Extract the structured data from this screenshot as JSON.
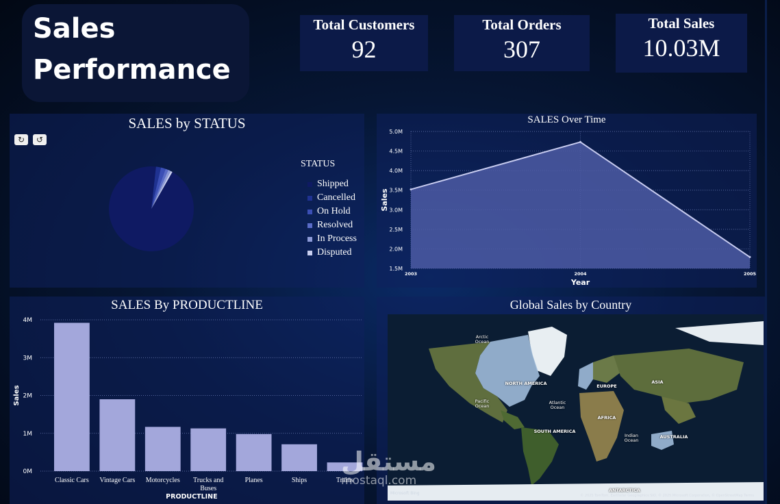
{
  "header": {
    "title_line1": "Sales",
    "title_line2": "Performance"
  },
  "kpis": [
    {
      "label": "Total Customers",
      "value": "92"
    },
    {
      "label": "Total Orders",
      "value": "307"
    },
    {
      "label": "Total Sales",
      "value": "10.03M"
    }
  ],
  "status_panel": {
    "title": "SALES by STATUS",
    "legend_title": "STATUS",
    "chart_data": {
      "type": "pie",
      "categories": [
        "Shipped",
        "Cancelled",
        "On Hold",
        "Resolved",
        "In Process",
        "Disputed"
      ],
      "values": [
        93.5,
        1.9,
        1.8,
        1.1,
        1.0,
        0.7
      ],
      "colors": [
        "#0f1a63",
        "#1f3291",
        "#3b4fb5",
        "#5a6cc8",
        "#8c9ad8",
        "#c9cff0"
      ]
    }
  },
  "time_panel": {
    "title": "SALES Over Time",
    "chart_data": {
      "type": "area",
      "x": [
        "2003",
        "2004",
        "2005"
      ],
      "values": [
        3.52,
        4.73,
        1.79
      ],
      "ylim": [
        1.5,
        5.0
      ],
      "yticks": [
        "1.5M",
        "2.0M",
        "2.5M",
        "3.0M",
        "3.5M",
        "4.0M",
        "4.5M",
        "5.0M"
      ],
      "xlabel": "Year",
      "ylabel": "Sales",
      "grid": true
    }
  },
  "product_panel": {
    "title": "SALES By PRODUCTLINE",
    "chart_data": {
      "type": "bar",
      "categories": [
        "Classic Cars",
        "Vintage Cars",
        "Motorcycles",
        "Trucks and Buses",
        "Planes",
        "Ships",
        "Trains"
      ],
      "values": [
        3.92,
        1.9,
        1.17,
        1.13,
        0.98,
        0.71,
        0.23
      ],
      "ylim": [
        0,
        4
      ],
      "yticks": [
        "0M",
        "1M",
        "2M",
        "3M",
        "4M"
      ],
      "xlabel": "PRODUCTLINE",
      "ylabel": "Sales",
      "grid": true
    }
  },
  "map_panel": {
    "title": "Global Sales by Country",
    "labels": [
      "Arctic Ocean",
      "NORTH AMERICA",
      "EUROPE",
      "ASIA",
      "Pacific Ocean",
      "Atlantic Ocean",
      "AFRICA",
      "SOUTH AMERICA",
      "Indian Ocean",
      "AUSTRALIA",
      "ANTARCTICA"
    ],
    "attribution": "© 2025 TomTom, Earthstar Geographics SIO, © 2025 Microsoft Corporation, © OpenStreetMap  Terms",
    "bing": "Microsoft Bing"
  },
  "watermark": {
    "arabic": "مستقل",
    "latin": "mostaql.com"
  },
  "colors": {
    "bar": "#a3a7db",
    "area_fill": "#4c5aa3",
    "area_line": "#c8ccf0"
  }
}
